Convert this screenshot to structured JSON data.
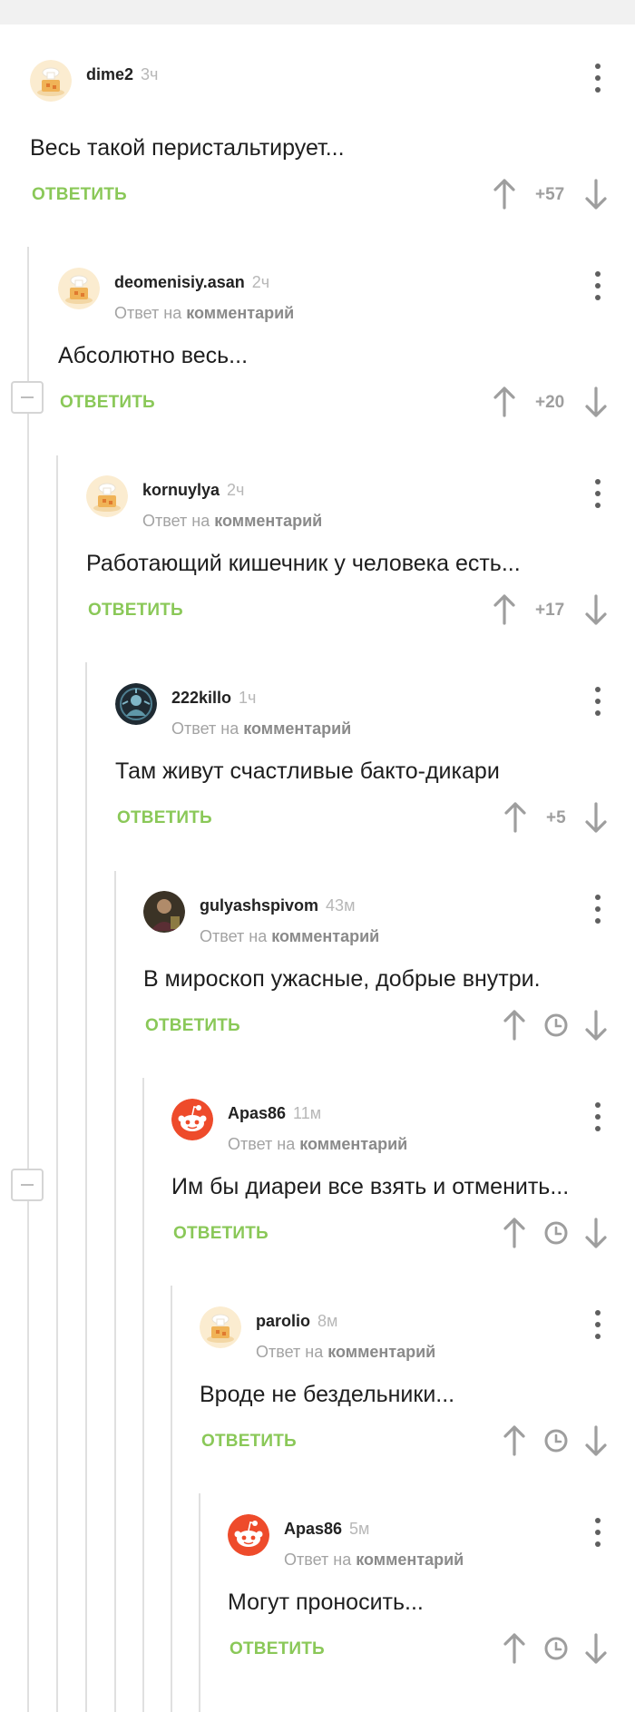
{
  "reply_to_prefix": "Ответ на",
  "reply_to_link": "комментарий",
  "reply_label": "ОТВЕТИТЬ",
  "comments": [
    {
      "username": "dime2",
      "time": "3ч",
      "text": "Весь такой перистальтирует...",
      "score": "+57",
      "avatar": "avatar-default-icon"
    },
    {
      "username": "deomenisiy.asan",
      "time": "2ч",
      "text": "Абсолютно весь...",
      "score": "+20",
      "avatar": "avatar-default-icon"
    },
    {
      "username": "kornuylya",
      "time": "2ч",
      "text": "Работающий кишечник у человека есть...",
      "score": "+17",
      "avatar": "avatar-default-icon"
    },
    {
      "username": "222killo",
      "time": "1ч",
      "text": "Там живут счастливые бакто-дикари",
      "score": "+5",
      "avatar": "avatar-photo-dark"
    },
    {
      "username": "gulyashspivom",
      "time": "43м",
      "text": "В мироскоп ужасные, добрые внутри.",
      "score": "",
      "avatar": "avatar-photo-person"
    },
    {
      "username": "Apas86",
      "time": "11м",
      "text": "Им бы диареи все взять и отменить...",
      "score": "",
      "avatar": "reddit-alien-icon"
    },
    {
      "username": "parolio",
      "time": "8м",
      "text": "Вроде не бездельники...",
      "score": "",
      "avatar": "avatar-default-icon"
    },
    {
      "username": "Apas86",
      "time": "5м",
      "text": "Могут проносить...",
      "score": "",
      "avatar": "reddit-alien-icon"
    }
  ],
  "colors": {
    "accent_green": "#8ac858",
    "reddit_orange": "#ee4b2b",
    "muted_gray": "#9e9e9e",
    "thread_line": "#e0e0e0"
  }
}
